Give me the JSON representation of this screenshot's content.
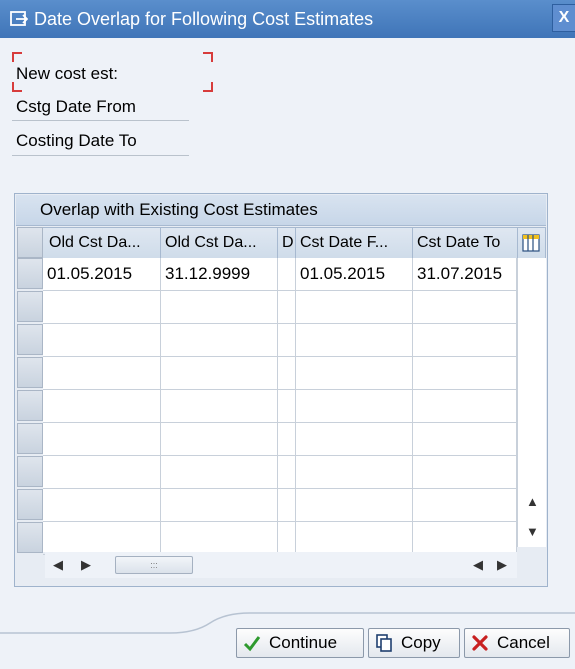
{
  "dialog": {
    "title": "Date Overlap for Following Cost Estimates",
    "close_glyph": "X"
  },
  "fields": {
    "new_cost_est": "New cost est:",
    "cstg_date_from": "Cstg Date From",
    "costing_date_to": "Costing Date To"
  },
  "table": {
    "title": "Overlap with Existing Cost Estimates",
    "columns": [
      "Old Cst Da...",
      "Old Cst Da...",
      "D",
      "Cst Date F...",
      "Cst Date To"
    ],
    "rows": [
      [
        "01.05.2015",
        "31.12.9999",
        "",
        "01.05.2015",
        "31.07.2015"
      ]
    ],
    "scroll_grip": ":::"
  },
  "buttons": {
    "continue": "Continue",
    "copy": "Copy",
    "cancel": "Cancel"
  },
  "colors": {
    "titlebar": "#3f75b8",
    "focus_mark": "#d73c3c",
    "continue_icon": "#2e9a2e",
    "cancel_icon": "#c82020"
  }
}
